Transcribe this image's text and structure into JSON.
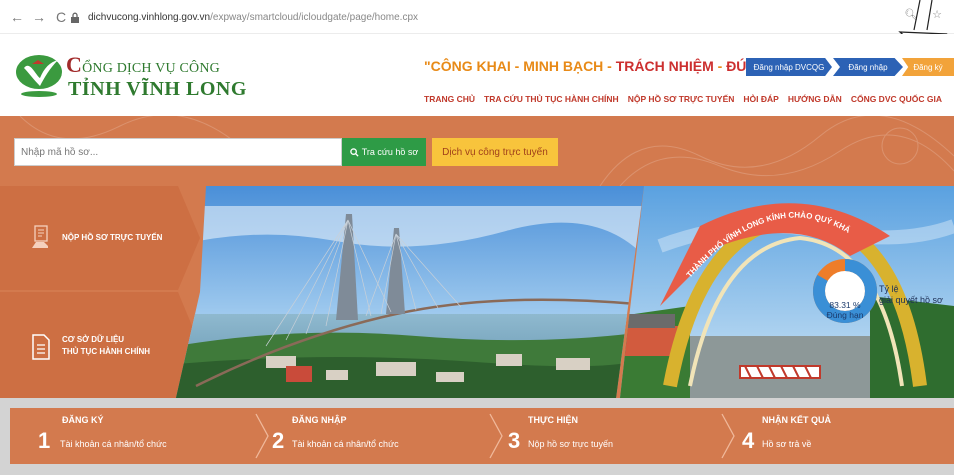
{
  "browser": {
    "url_host": "dichvucong.vinhlong.gov.vn",
    "url_path": "/expway/smartcloud/icloudgate/page/home.cpx"
  },
  "header": {
    "brand_line1": "ỔNG DỊCH VỤ CÔNG",
    "brand_line1_initial": "C",
    "brand_line2": "TỈNH VĨNH LONG",
    "slogan_part1": "\"CÔNG KHAI - MINH BẠCH - ",
    "slogan_part2": "TRÁCH NHIỆM",
    "slogan_part3": " - ",
    "slogan_part4": "ĐÚNG LUẬT\"",
    "login_dvcqg": "Đăng nhập DVCQG",
    "login": "Đăng nhập",
    "register": "Đăng ký",
    "nav": [
      {
        "label": "TRANG CHỦ"
      },
      {
        "label": "TRA CỨU THỦ TỤC HÀNH CHÍNH"
      },
      {
        "label": "NỘP HỒ SƠ TRỰC TUYẾN"
      },
      {
        "label": "HỎI ĐÁP"
      },
      {
        "label": "HƯỚNG DẪN"
      },
      {
        "label": "CỔNG DVC QUỐC GIA"
      }
    ]
  },
  "search": {
    "placeholder": "Nhập mã hồ sơ...",
    "button": "Tra cứu hồ sơ",
    "online_service": "Dịch vụ công trực tuyến"
  },
  "tiles": [
    {
      "line1": "NỘP HỒ SƠ TRỰC TUYẾN",
      "line2": ""
    },
    {
      "line1": "CƠ SỞ DỮ LIỆU",
      "line2": "THỦ TỤC HÀNH CHÍNH"
    }
  ],
  "banner_text": "THÀNH PHỐ VĨNH LONG KÍNH CHÀO QUÝ KHÁCH",
  "stats": {
    "on_time_percent": 83.31,
    "percent_label": "83.31 %",
    "on_time_label": "Đúng hạn",
    "rate_line1": "Tỷ lệ",
    "rate_line2": "giải quyết hồ sơ"
  },
  "steps": [
    {
      "num": "1",
      "title": "ĐĂNG KÝ",
      "desc": "Tài khoản cá nhân/tổ chức"
    },
    {
      "num": "2",
      "title": "ĐĂNG NHẬP",
      "desc": "Tài khoản cá nhân/tổ chức"
    },
    {
      "num": "3",
      "title": "THỰC HIỆN",
      "desc": "Nộp hồ sơ trực tuyến"
    },
    {
      "num": "4",
      "title": "NHẬN KẾT QUẢ",
      "desc": "Hồ sơ trả về"
    }
  ],
  "colors": {
    "primary_orange": "#d37a4e",
    "brand_green": "#2f7a2f",
    "button_blue": "#2c62b5",
    "button_green": "#2e9b46",
    "button_yellow": "#f8c43c",
    "donut_blue": "#3a8fd6",
    "donut_orange": "#ee7d2a"
  }
}
